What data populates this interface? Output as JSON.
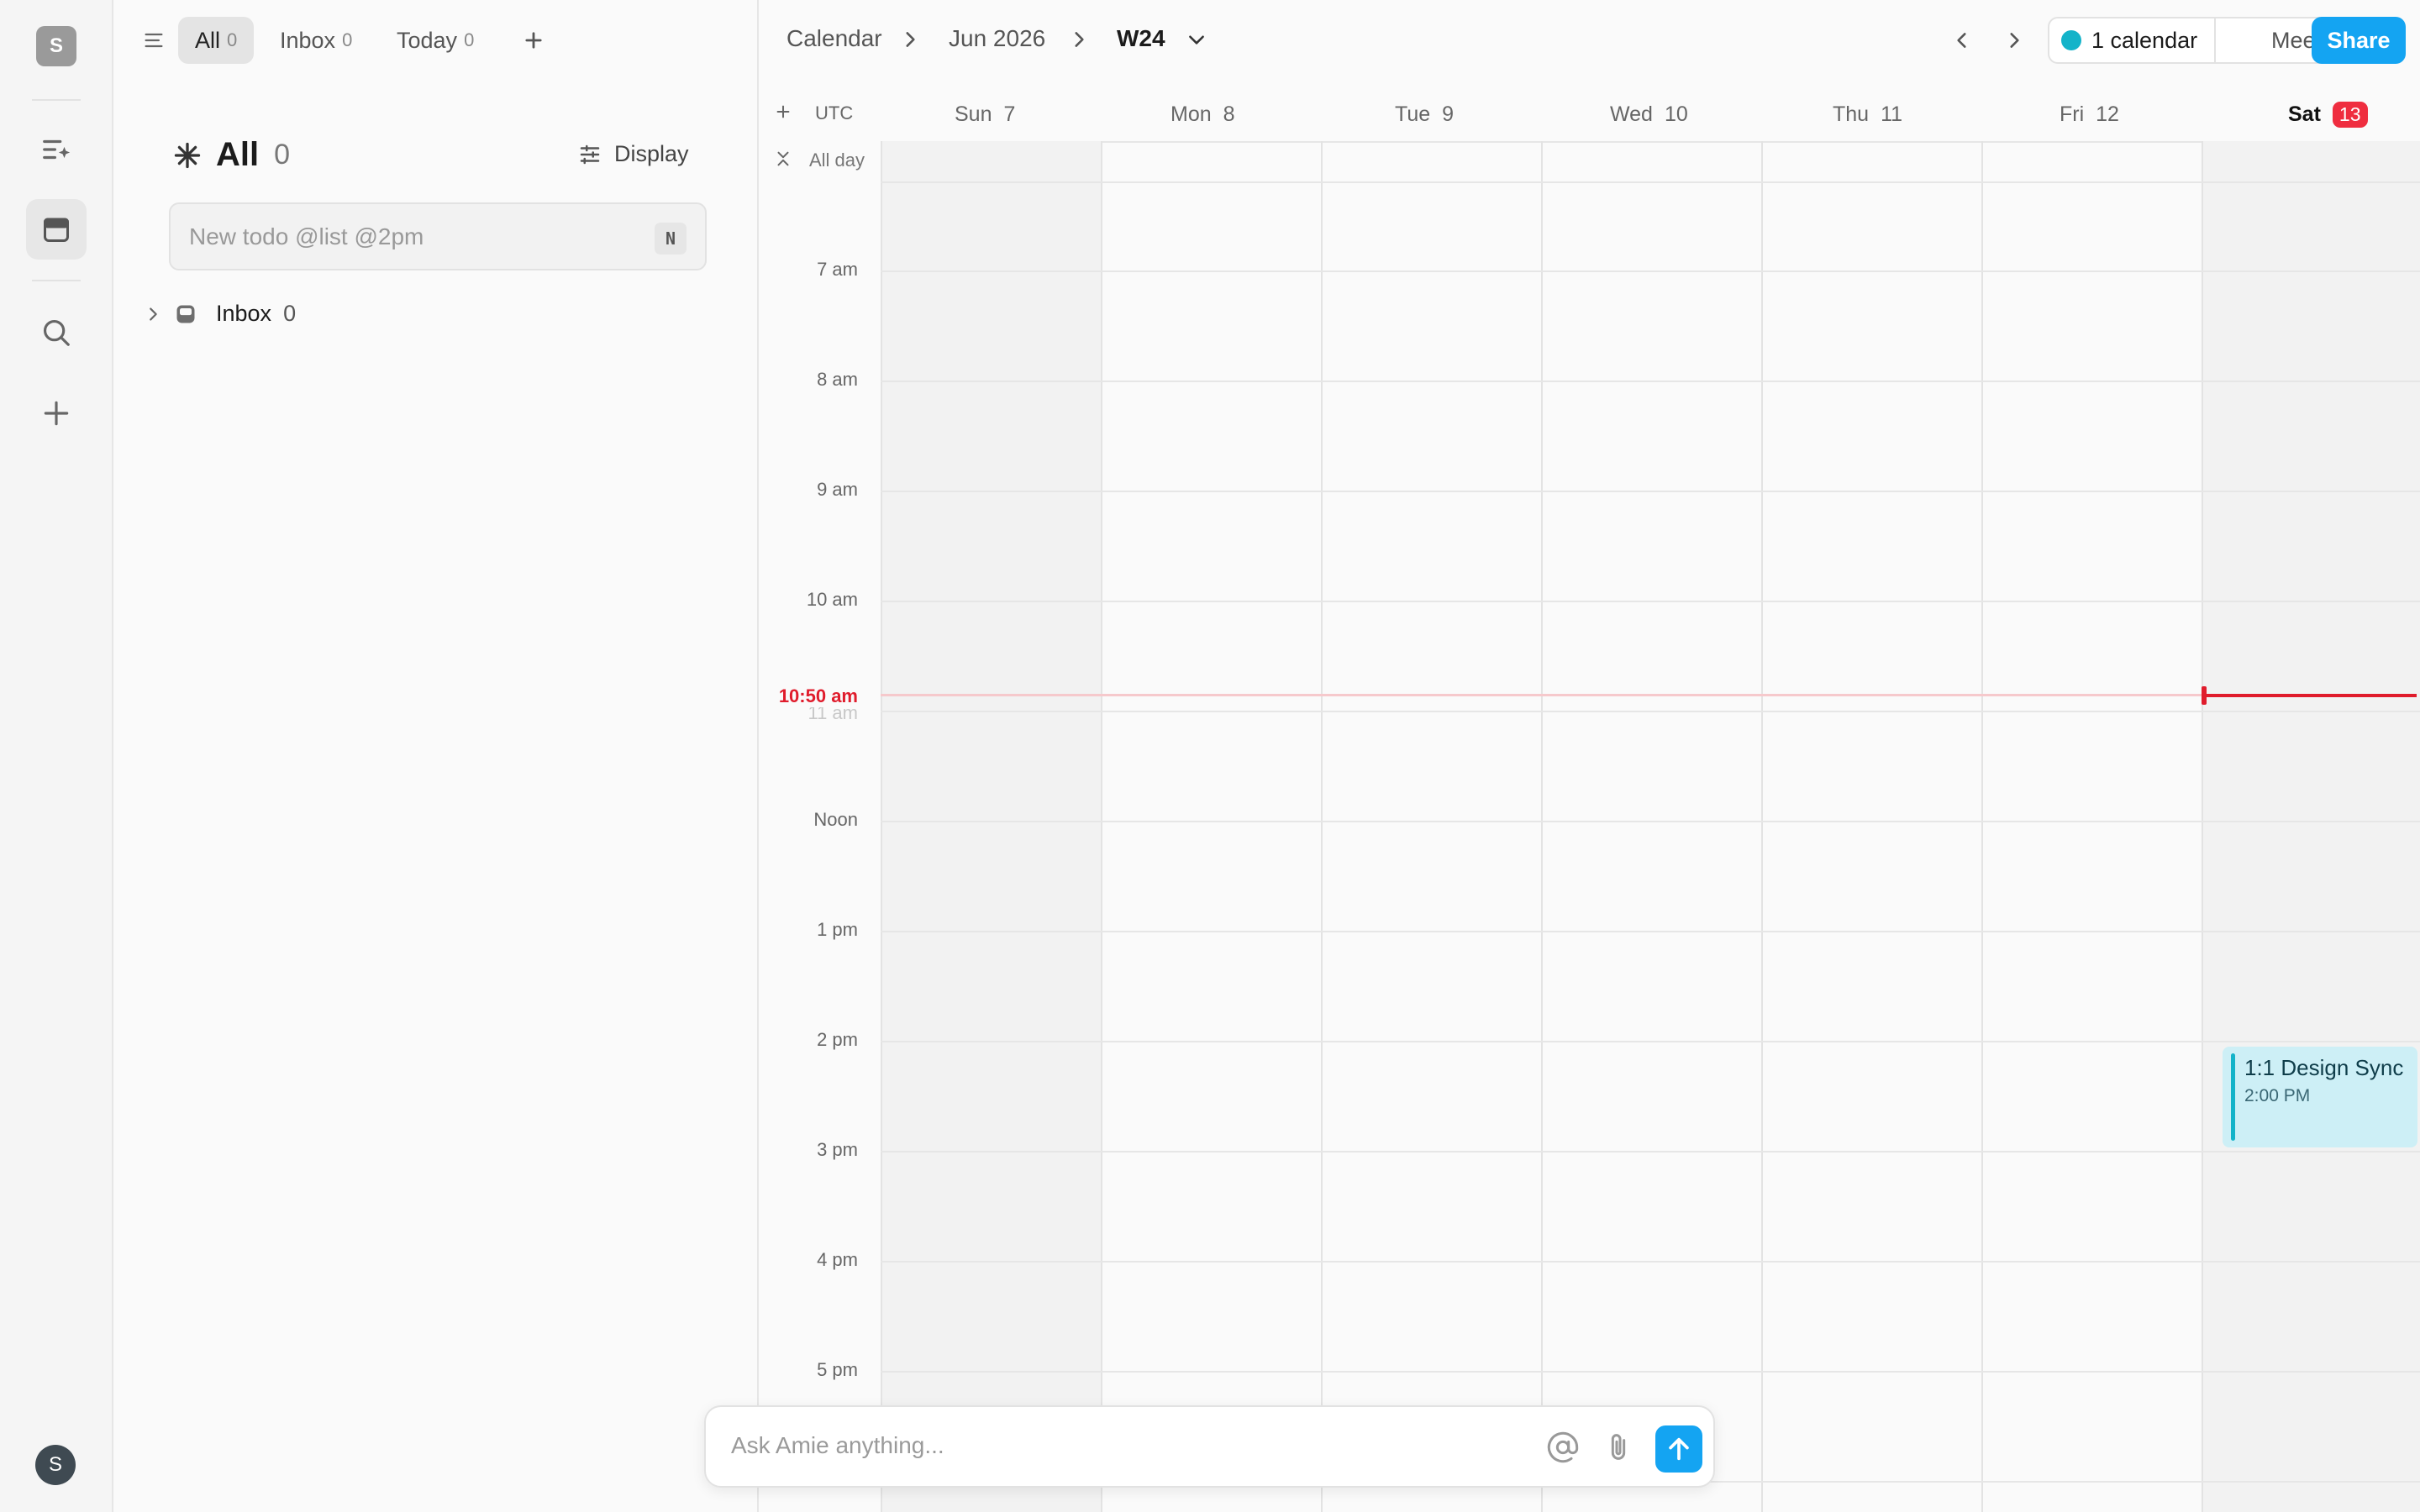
{
  "rail": {
    "workspace_initial": "S",
    "user_initial": "S",
    "icons": [
      "ai-tasks-icon",
      "calendar-icon",
      "search-icon",
      "plus-icon"
    ]
  },
  "todo": {
    "tabs": [
      {
        "label": "All",
        "count": "0"
      },
      {
        "label": "Inbox",
        "count": "0"
      },
      {
        "label": "Today",
        "count": "0"
      }
    ],
    "list_title": "All",
    "list_count": "0",
    "display_label": "Display",
    "new_todo_placeholder": "New todo @list @2pm",
    "new_todo_shortcut": "N",
    "inbox_label": "Inbox",
    "inbox_count": "0"
  },
  "calendar": {
    "breadcrumb": [
      "Calendar",
      "Jun 2026",
      "W24"
    ],
    "calendar_count_label": "1 calendar",
    "calendar_color": "#13b3c9",
    "meet_label": "Meet",
    "share_label": "Share",
    "timezone": "UTC",
    "allday_label": "All day",
    "days": [
      {
        "name": "Sun",
        "num": "7"
      },
      {
        "name": "Mon",
        "num": "8"
      },
      {
        "name": "Tue",
        "num": "9"
      },
      {
        "name": "Wed",
        "num": "10"
      },
      {
        "name": "Thu",
        "num": "11"
      },
      {
        "name": "Fri",
        "num": "12"
      },
      {
        "name": "Sat",
        "num": "13"
      }
    ],
    "hours": [
      "7 am",
      "8 am",
      "9 am",
      "10 am",
      "11 am",
      "Noon",
      "1 pm",
      "2 pm",
      "3 pm",
      "4 pm",
      "5 pm"
    ],
    "now_label": "10:50 am",
    "event": {
      "title": "1:1 Design Sync",
      "time": "2:00 PM"
    }
  },
  "ask": {
    "placeholder": "Ask Amie anything..."
  },
  "colors": {
    "accent": "#14a4f2",
    "now": "#e01c2c",
    "today_badge": "#ef2d3f"
  }
}
